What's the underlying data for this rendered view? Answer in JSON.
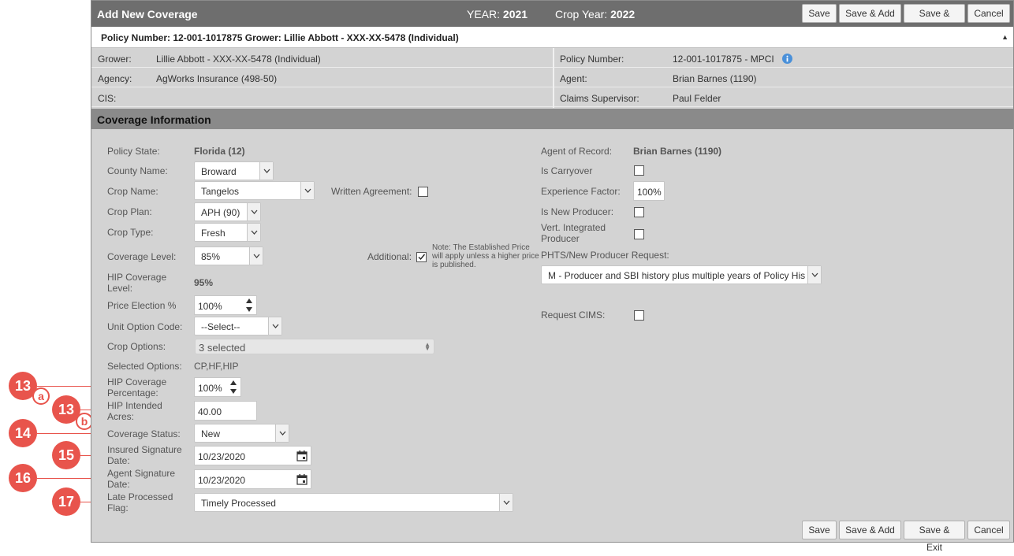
{
  "header": {
    "title": "Add New Coverage",
    "year_label": "YEAR:",
    "year_value": "2021",
    "crop_year_label": "Crop Year:",
    "crop_year_value": "2022",
    "buttons": {
      "save": "Save",
      "save_add": "Save & Add",
      "save_exit": "Save & Exit",
      "cancel": "Cancel"
    }
  },
  "policy_bar": {
    "text": "Policy Number: 12-001-1017875 Grower: Lillie Abbott - XXX-XX-5478 (Individual)",
    "collapse_icon": "triangle-up-icon"
  },
  "info": {
    "grower_label": "Grower:",
    "grower_value": "Lillie Abbott - XXX-XX-5478 (Individual)",
    "agency_label": "Agency:",
    "agency_value": "AgWorks Insurance (498-50)",
    "cis_label": "CIS:",
    "policy_number_label": "Policy Number:",
    "policy_number_value": "12-001-1017875 - MPCI",
    "agent_label": "Agent:",
    "agent_value": "Brian Barnes (1190)",
    "claims_supervisor_label": "Claims Supervisor:",
    "claims_supervisor_value": "Paul Felder"
  },
  "section": {
    "title": "Coverage Information"
  },
  "form": {
    "policy_state_label": "Policy State:",
    "policy_state_value": "Florida (12)",
    "county_label": "County Name:",
    "county_value": "Broward",
    "crop_name_label": "Crop Name:",
    "crop_name_value": "Tangelos",
    "written_agreement_label": "Written Agreement:",
    "crop_plan_label": "Crop Plan:",
    "crop_plan_value": "APH (90)",
    "crop_type_label": "Crop Type:",
    "crop_type_value": "Fresh",
    "coverage_level_label": "Coverage Level:",
    "coverage_level_value": "85%",
    "additional_label": "Additional:",
    "additional_checked": true,
    "note": "Note: The Established Price will apply unless a higher price is published.",
    "hip_coverage_level_label_1": "HIP Coverage",
    "hip_coverage_level_label_2": "Level:",
    "hip_coverage_level_value": "95%",
    "price_election_label": "Price Election %",
    "price_election_value": "100%",
    "unit_option_label": "Unit Option Code:",
    "unit_option_value": "--Select--",
    "crop_options_label": "Crop Options:",
    "crop_options_value": "3 selected",
    "selected_options_label": "Selected Options:",
    "selected_options_value": "CP,HF,HIP",
    "hip_coverage_pct_label_1": "HIP Coverage",
    "hip_coverage_pct_label_2": "Percentage:",
    "hip_coverage_pct_value": "100%",
    "hip_acres_label_1": "HIP Intended",
    "hip_acres_label_2": "Acres:",
    "hip_acres_value": "40.00",
    "coverage_status_label": "Coverage Status:",
    "coverage_status_value": "New",
    "insured_sig_label_1": "Insured Signature",
    "insured_sig_label_2": "Date:",
    "insured_sig_value": "10/23/2020",
    "agent_sig_label_1": "Agent Signature",
    "agent_sig_label_2": "Date:",
    "agent_sig_value": "10/23/2020",
    "late_flag_label_1": "Late Processed",
    "late_flag_label_2": "Flag:",
    "late_flag_value": "Timely Processed",
    "agent_of_record_label": "Agent of Record:",
    "agent_of_record_value": "Brian Barnes (1190)",
    "is_carryover_label": "Is Carryover",
    "experience_factor_label": "Experience Factor:",
    "experience_factor_value": "100%",
    "is_new_producer_label": "Is New Producer:",
    "vert_integrated_label_1": "Vert. Integrated",
    "vert_integrated_label_2": "Producer",
    "phts_label": "PHTS/New Producer Request:",
    "phts_value": "M - Producer and SBI history plus multiple years of Policy His",
    "request_cims_label": "Request CIMS:"
  },
  "callouts": {
    "c13": "13",
    "c13a": "a",
    "c13b": "b",
    "c14": "14",
    "c15": "15",
    "c16": "16",
    "c17": "17"
  },
  "colors": {
    "callout": "#e8544c",
    "header": "#6e6e6e",
    "section": "#8a8a8a",
    "panel": "#d3d3d3"
  }
}
